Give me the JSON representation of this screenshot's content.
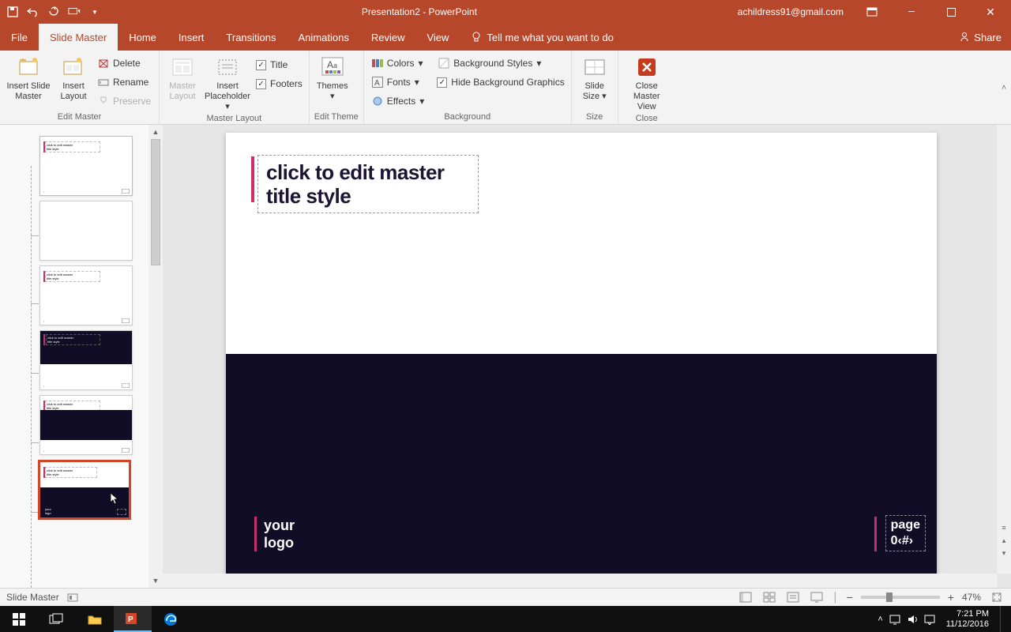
{
  "titlebar": {
    "title": "Presentation2  -  PowerPoint",
    "account": "achildress91@gmail.com"
  },
  "tabs": {
    "file": "File",
    "slide_master": "Slide Master",
    "home": "Home",
    "insert": "Insert",
    "transitions": "Transitions",
    "animations": "Animations",
    "review": "Review",
    "view": "View",
    "tellme": "Tell me what you want to do",
    "share": "Share"
  },
  "ribbon": {
    "edit_master": {
      "insert_slide_master": "Insert Slide\nMaster",
      "insert_layout": "Insert\nLayout",
      "delete": "Delete",
      "rename": "Rename",
      "preserve": "Preserve",
      "label": "Edit Master"
    },
    "master_layout": {
      "master_layout": "Master\nLayout",
      "insert_placeholder": "Insert\nPlaceholder",
      "title": "Title",
      "footers": "Footers",
      "label": "Master Layout"
    },
    "edit_theme": {
      "themes": "Themes",
      "label": "Edit Theme"
    },
    "background": {
      "colors": "Colors",
      "fonts": "Fonts",
      "effects": "Effects",
      "bg_styles": "Background Styles",
      "hide_bg": "Hide Background Graphics",
      "label": "Background"
    },
    "size": {
      "slide_size": "Slide\nSize",
      "label": "Size"
    },
    "close": {
      "close_master": "Close\nMaster View",
      "label": "Close"
    }
  },
  "slide": {
    "title_placeholder": "click to edit master title style",
    "logo_line1": "your",
    "logo_line2": "logo",
    "page_line1": "page",
    "page_line2": "0‹#›"
  },
  "status": {
    "mode": "Slide Master",
    "zoom": "47%"
  },
  "tray": {
    "time": "7:21 PM",
    "date": "11/12/2016"
  }
}
